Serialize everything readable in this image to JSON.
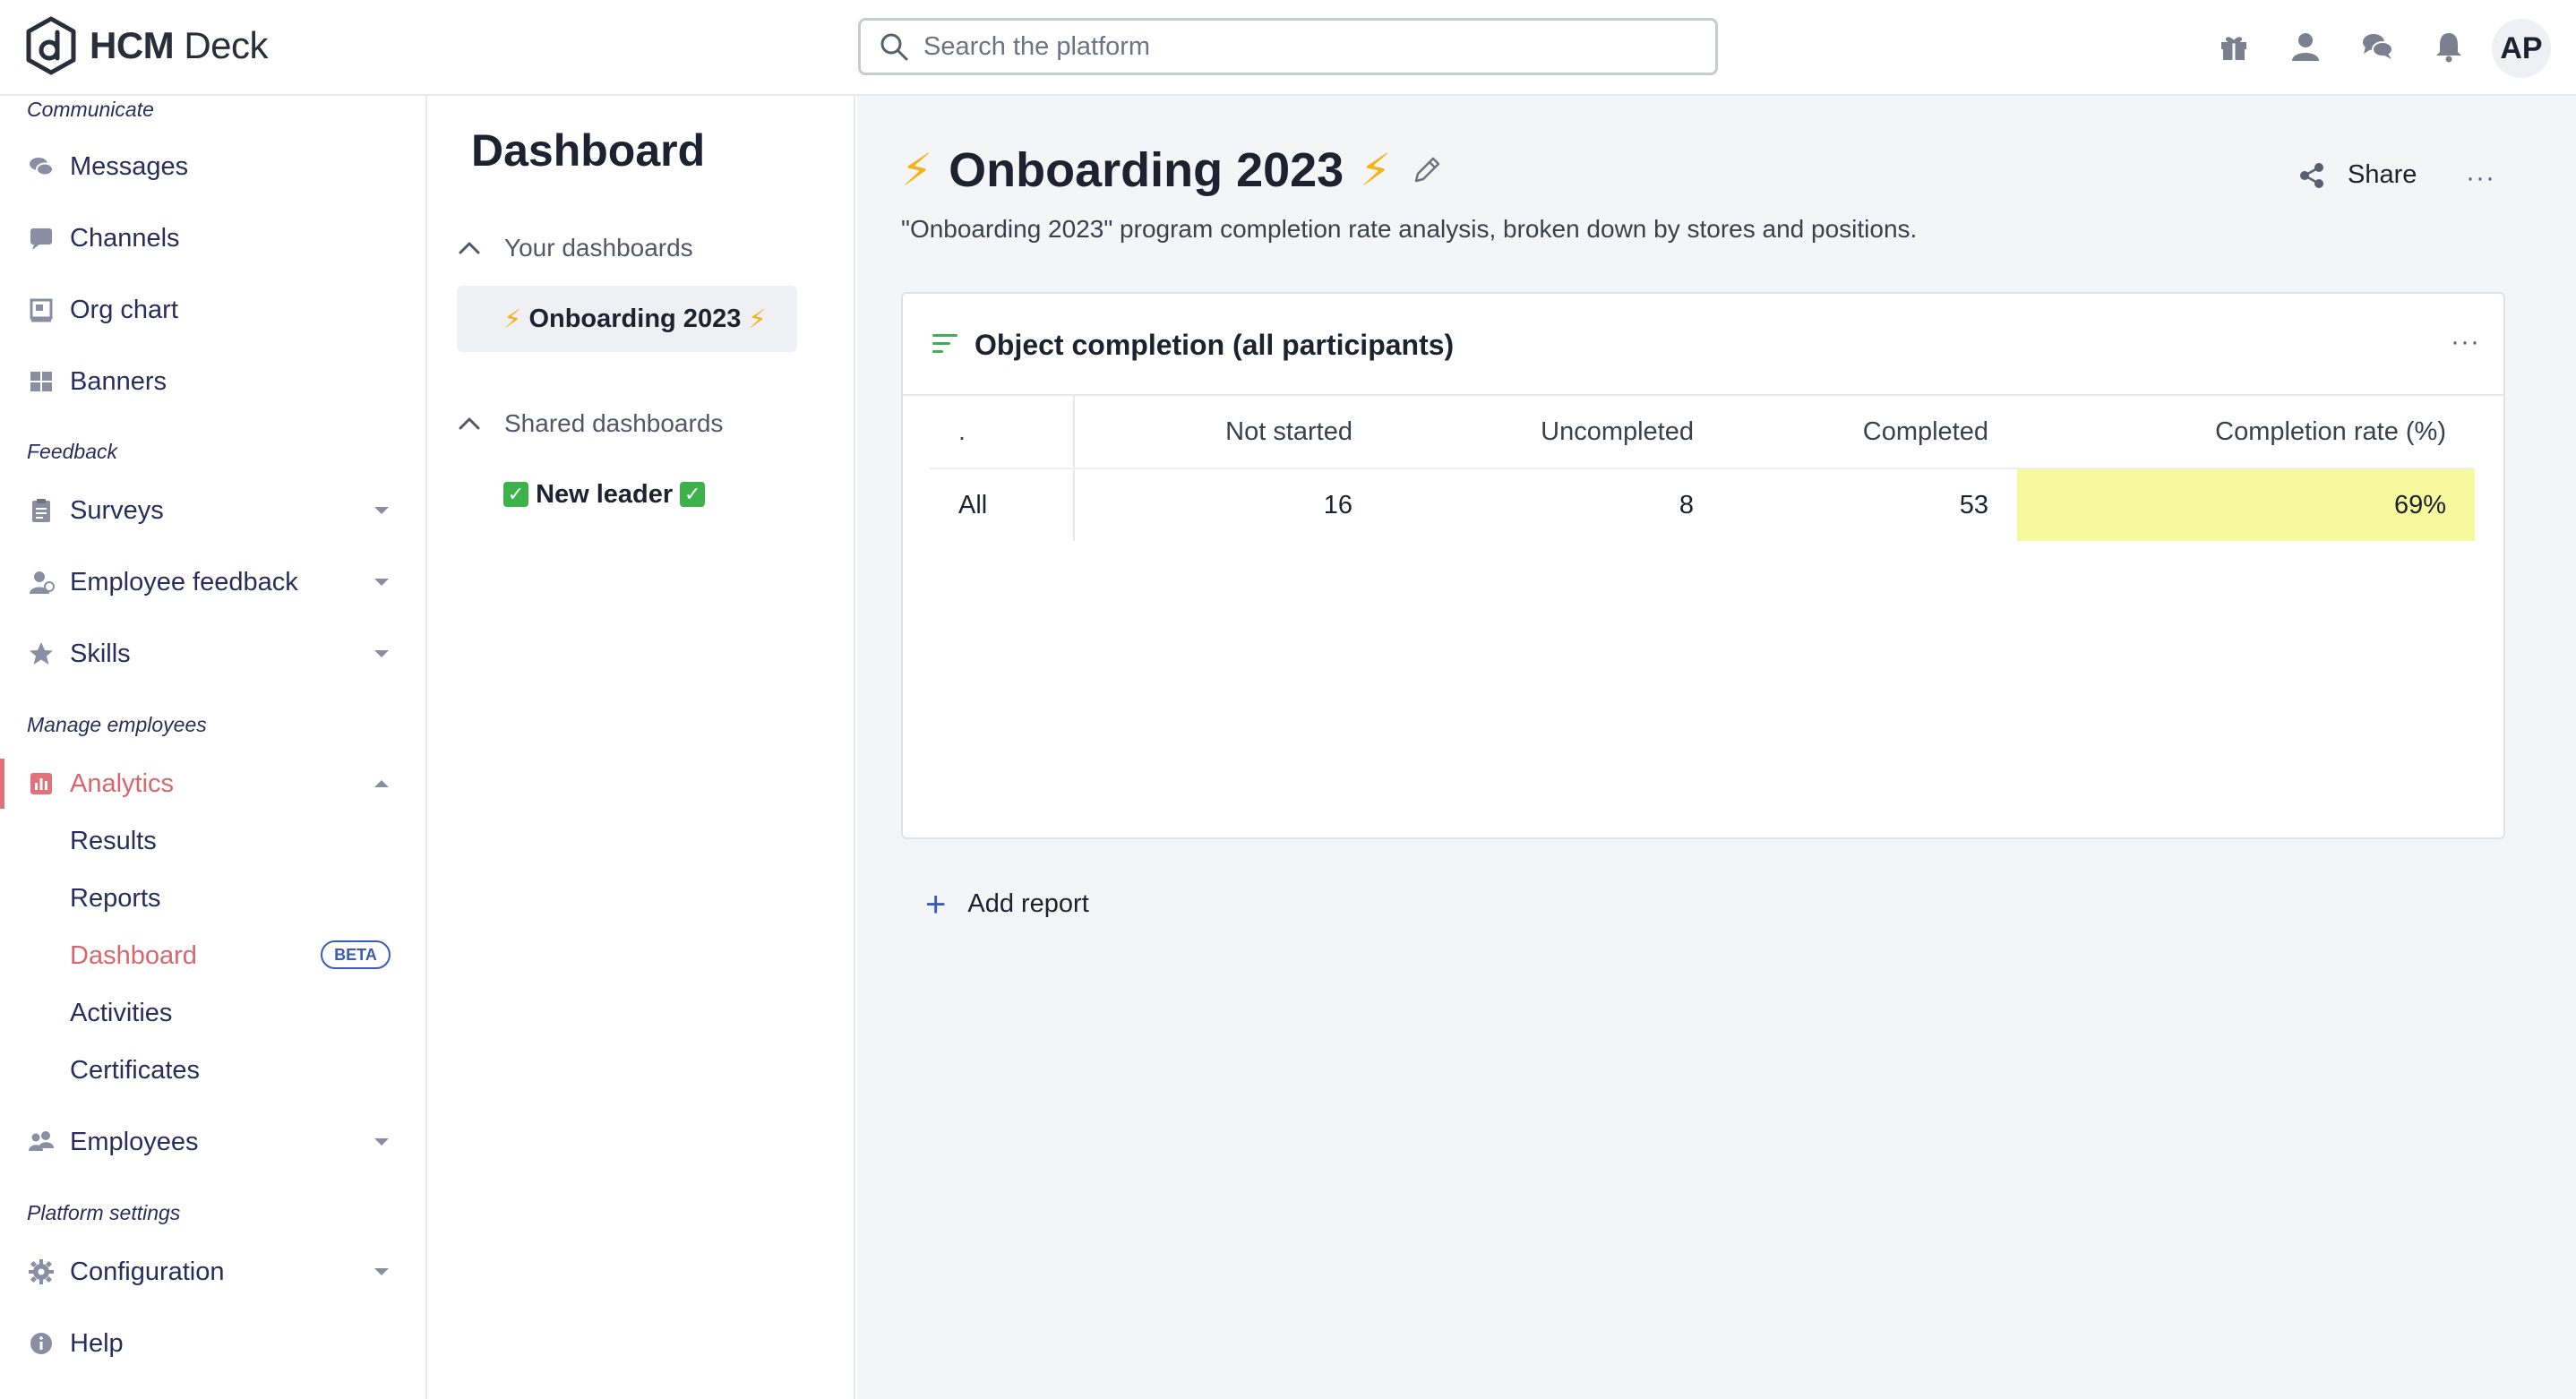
{
  "header": {
    "brand_bold": "HCM",
    "brand_rest": " Deck",
    "search_placeholder": "Search the platform",
    "avatar_initials": "AP",
    "icons": [
      "gift-icon",
      "user-icon",
      "chat-icon",
      "bell-icon"
    ]
  },
  "sidebar": {
    "sections": {
      "communicate": "Communicate",
      "feedback": "Feedback",
      "manage": "Manage employees",
      "platform": "Platform settings"
    },
    "items": {
      "messages": "Messages",
      "channels": "Channels",
      "org_chart": "Org chart",
      "banners": "Banners",
      "surveys": "Surveys",
      "employee_feedback": "Employee feedback",
      "skills": "Skills",
      "analytics": "Analytics",
      "employees": "Employees",
      "configuration": "Configuration",
      "help": "Help"
    },
    "analytics_sub": {
      "results": "Results",
      "reports": "Reports",
      "dashboard": "Dashboard",
      "activities": "Activities",
      "certificates": "Certificates"
    },
    "beta_badge": "BETA",
    "accent_color": "#d9666f"
  },
  "dashboards": {
    "heading": "Dashboard",
    "your_label": "Your dashboards",
    "your_items": [
      "Onboarding 2023"
    ],
    "shared_label": "Shared dashboards",
    "shared_items": [
      "New leader"
    ],
    "bolt": "⚡",
    "check": "✓"
  },
  "main": {
    "title": "Onboarding 2023",
    "bolt": "⚡",
    "subtitle": "\"Onboarding 2023\" program completion rate analysis, broken down by stores and positions.",
    "share_label": "Share",
    "more_label": "···",
    "card": {
      "title": "Object completion (all participants)",
      "columns": [
        ".",
        "Not started",
        "Uncompleted",
        "Completed",
        "Completion rate (%)"
      ],
      "rows": [
        {
          "label": "All",
          "not_started": "16",
          "uncompleted": "8",
          "completed": "53",
          "completion_rate": "69%"
        }
      ],
      "highlight_color": "#f7fa9c"
    },
    "add_report_label": "Add report"
  }
}
